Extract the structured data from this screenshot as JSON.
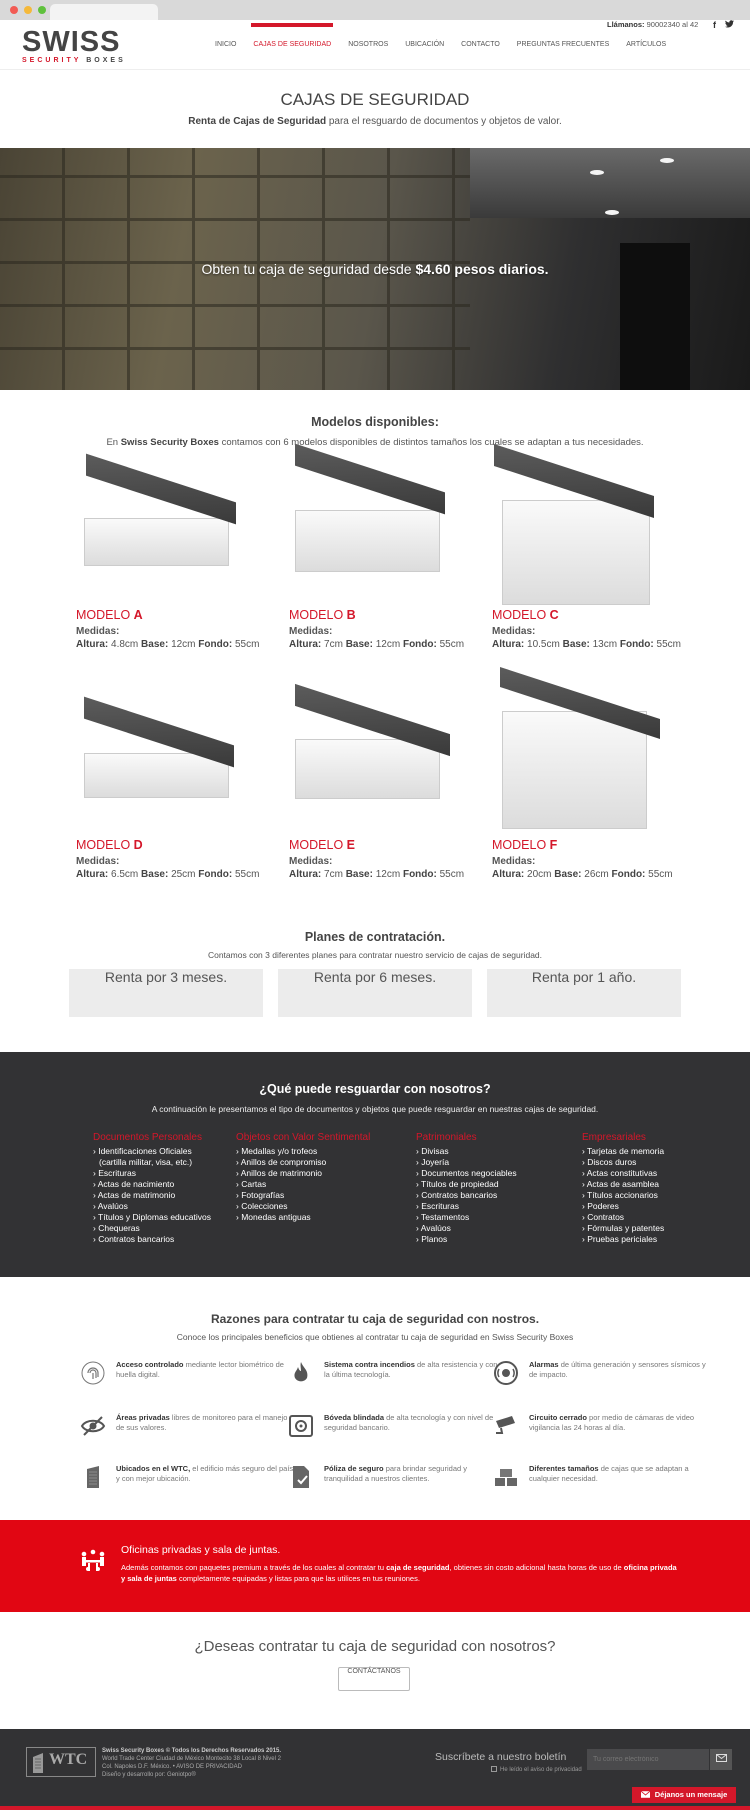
{
  "header": {
    "logo_main": "SWISS",
    "logo_sub_red": "SECURITY",
    "logo_sub_rest": "BOXES",
    "nav": [
      "INICIO",
      "CAJAS DE SEGURIDAD",
      "NOSOTROS",
      "UBICACIÓN",
      "CONTACTO",
      "PREGUNTAS FRECUENTES",
      "ARTÍCULOS"
    ],
    "active_nav": "CAJAS DE SEGURIDAD",
    "call_label": "Llámanos:",
    "call_number": "90002340 al 42",
    "social": [
      "facebook-icon",
      "twitter-icon"
    ],
    "social_glyphs": [
      "f",
      "🐦"
    ]
  },
  "intro": {
    "title": "CAJAS DE SEGURIDAD",
    "subtitle_bold": "Renta de Cajas de Seguridad",
    "subtitle_rest": " para el resguardo de documentos y objetos de valor."
  },
  "hero": {
    "text_pre": "Obten tu caja de seguridad desde ",
    "text_bold": "$4.60 pesos diarios."
  },
  "models_section": {
    "title": "Modelos disponibles:",
    "sub_pre": "En ",
    "sub_bold": "Swiss Security Boxes",
    "sub_rest": " contamos con 6 modelos disponibles de distintos tamaños los cuales se adaptan a tus necesidades.",
    "measures_label": "Medidas:",
    "altura": "Altura:",
    "base": "Base:",
    "fondo": "Fondo:",
    "models": [
      {
        "prefix": "MODELO ",
        "letter": "A",
        "altura": "4.8cm",
        "base": "12cm",
        "fondo": "55cm"
      },
      {
        "prefix": "MODELO ",
        "letter": "B",
        "altura": "7cm",
        "base": "12cm",
        "fondo": "55cm"
      },
      {
        "prefix": "MODELO ",
        "letter": "C",
        "altura": "10.5cm",
        "base": "13cm",
        "fondo": "55cm"
      },
      {
        "prefix": "MODELO ",
        "letter": "D",
        "altura": "6.5cm",
        "base": "25cm",
        "fondo": "55cm"
      },
      {
        "prefix": "MODELO ",
        "letter": "E",
        "altura": "7cm",
        "base": "12cm",
        "fondo": "55cm"
      },
      {
        "prefix": "MODELO ",
        "letter": "F",
        "altura": "20cm",
        "base": "26cm",
        "fondo": "55cm"
      }
    ]
  },
  "plans": {
    "title": "Planes de contratación.",
    "subtitle": "Contamos con 3 diferentes planes para contratar nuestro servicio de cajas de seguridad.",
    "options": [
      "Renta por 3 meses.",
      "Renta por 6 meses.",
      "Renta por 1 año."
    ]
  },
  "storage": {
    "title": "¿Qué puede resguardar con nosotros?",
    "subtitle": "A continuación le presentamos el tipo de documentos y objetos que puede resguardar en nuestras cajas de seguridad.",
    "columns": [
      {
        "title": "Documentos Personales",
        "items": [
          "Identificaciones Oficiales",
          "(cartilla militar, visa, etc.)",
          "Escrituras",
          "Actas de nacimiento",
          "Actas de matrimonio",
          "Avalúos",
          "Títulos y Diplomas educativos",
          "Chequeras",
          "Contratos bancarios"
        ]
      },
      {
        "title": "Objetos con Valor Sentimental",
        "items": [
          "Medallas y/o trofeos",
          "Anillos de compromiso",
          "Anillos de matrimonio",
          "Cartas",
          "Fotografías",
          "Colecciones",
          "Monedas antiguas"
        ]
      },
      {
        "title": "Patrimoniales",
        "items": [
          "Divisas",
          "Joyería",
          "Documentos negociables",
          "Títulos de propiedad",
          "Contratos bancarios",
          "Escrituras",
          "Testamentos",
          "Avalúos",
          "Planos"
        ]
      },
      {
        "title": "Empresariales",
        "items": [
          "Tarjetas de memoria",
          "Discos duros",
          "Actas constitutivas",
          "Actas de asamblea",
          "Títulos accionarios",
          "Poderes",
          "Contratos",
          "Fórmulas y patentes",
          "Pruebas periciales"
        ]
      }
    ]
  },
  "reasons": {
    "title": "Razones para contratar tu caja de seguridad con nostros.",
    "subtitle": "Conoce los principales beneficios que obtienes al contratar tu caja de seguridad en Swiss Security Boxes",
    "items": [
      {
        "icon": "fingerprint-icon",
        "bold": "Acceso controlado",
        "rest": " mediante lector biométrico de huella digital."
      },
      {
        "icon": "fire-icon",
        "bold": "Sistema contra incendios",
        "rest": " de alta resistencia y con la última tecnología."
      },
      {
        "icon": "alarm-icon",
        "bold": "Alarmas",
        "rest": " de última generación y sensores sísmicos y de impacto."
      },
      {
        "icon": "eye-slash-icon",
        "bold": "Áreas privadas",
        "rest": " libres de monitoreo para el manejo de sus valores."
      },
      {
        "icon": "vault-icon",
        "bold": "Bóveda blindada",
        "rest": " de alta tecnología y con nivel de seguridad bancario."
      },
      {
        "icon": "camera-icon",
        "bold": "Circuito cerrado",
        "rest": " por medio de cámaras de video vigilancia las 24 horas al día."
      },
      {
        "icon": "building-icon",
        "bold": "Ubicados en el WTC,",
        "rest": " el edificio más seguro del país y con mejor ubicación."
      },
      {
        "icon": "policy-icon",
        "bold": "Póliza de seguro",
        "rest": " para brindar seguridad y tranquilidad a nuestros clientes."
      },
      {
        "icon": "boxes-icon",
        "bold": "Diferentes tamaños",
        "rest": " de cajas que se adaptan a cualquier necesidad."
      }
    ]
  },
  "offices": {
    "title": "Oficinas privadas y sala de juntas.",
    "text_1": "Además contamos con paquetes premium a través de los cuales al contratar tu ",
    "text_bold_1": "caja de seguridad",
    "text_2": ", obtienes sin costo adicional hasta horas de uso de ",
    "text_bold_2": "oficina privada y sala de juntas",
    "text_3": " completamente equipadas y listas para que las utilices en tus reuniones."
  },
  "cta": {
    "title": "¿Deseas contratar tu caja de seguridad con nosotros?",
    "button": "CONTÁCTANOS"
  },
  "footer": {
    "logo_text": "WTC",
    "copyright": "Swiss Security Boxes © Todos los Derechos Reservados 2015.",
    "address_1": "World Trade Center Ciudad de México Montecito 38 Local 8 Nivel 2",
    "address_2": "Col. Napoles D.F. México.  •  AVISO DE PRIVACIDAD",
    "credit": "Diseño y desarrollo por: Geniotpo®",
    "newsletter_title": "Suscríbete a nuestro boletín",
    "newsletter_check": "He leído el aviso de privacidad",
    "newsletter_placeholder": "Tu correo electrónico",
    "message_button": "Déjanos un mensaje"
  },
  "colors": {
    "accent": "#d4172a",
    "dark": "#323234",
    "band": "#e10613"
  }
}
